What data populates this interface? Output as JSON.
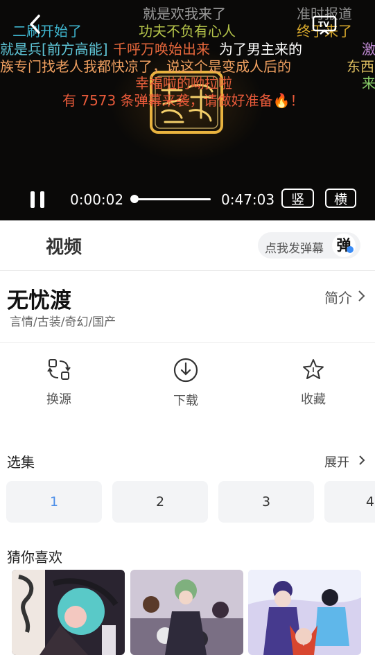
{
  "player": {
    "current_time": "0:00:02",
    "total_time": "0:47:03",
    "progress": 0.0007,
    "portrait_label": "竖",
    "landscape_label": "横",
    "danmaku": [
      {
        "text": "就是欢我来了",
        "color": "#9a9a9a"
      },
      {
        "text": "准时报道",
        "color": "#8f8f8f"
      },
      {
        "text": "二刷开始了",
        "color": "#3fb6cf"
      },
      {
        "text": "功夫不负有心人",
        "color": "#b5c44a"
      },
      {
        "text": "终于来了",
        "color": "#d9a92c"
      },
      {
        "text": "就是兵[前方高能]",
        "color": "#5fc6d8"
      },
      {
        "text": "千呼万唤始出来",
        "color": "#e8683c"
      },
      {
        "text": "为了男主来的",
        "color": "#ffffff"
      },
      {
        "text": "激",
        "color": "#c28bd6"
      },
      {
        "text": "族专门找老人我都快凉了，说这个是变成人后的",
        "color": "#f0a060"
      },
      {
        "text": "东西",
        "color": "#e0c060"
      },
      {
        "text": "来",
        "color": "#8ad06a"
      },
      {
        "text": "幸福啦的呦拉啦",
        "color": "#e8603c"
      },
      {
        "text": "有 7573 条弹幕来袭，请做好准备🔥！",
        "color": "#e85a3a"
      }
    ]
  },
  "tabs": {
    "video_label": "视频",
    "danmu_prompt": "点我发弹幕",
    "danmu_icon_char": "弹"
  },
  "show": {
    "title": "无忧渡",
    "intro_label": "简介",
    "genre": "言情/古装/奇幻/国产"
  },
  "actions": [
    {
      "label": "换源",
      "icon": "switch-source-icon"
    },
    {
      "label": "下载",
      "icon": "download-icon"
    },
    {
      "label": "收藏",
      "icon": "favorite-star-icon"
    }
  ],
  "episodes": {
    "section_title": "选集",
    "expand_label": "展开",
    "items": [
      "1",
      "2",
      "3",
      "4"
    ],
    "selected": "1",
    "accent": "#4a8de8"
  },
  "recommend": {
    "section_title": "猜你喜欢"
  }
}
